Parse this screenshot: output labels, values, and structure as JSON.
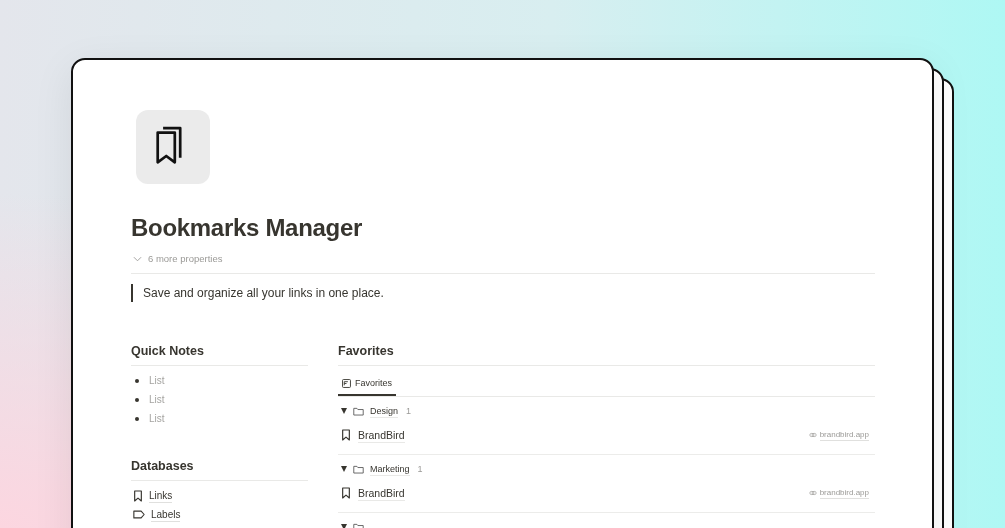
{
  "page": {
    "title": "Bookmarks Manager",
    "properties_toggle": "6 more properties",
    "quote": "Save and organize all your links in one place."
  },
  "quick_notes": {
    "heading": "Quick Notes",
    "items": [
      "List",
      "List",
      "List"
    ]
  },
  "databases": {
    "heading": "Databases",
    "items": [
      {
        "label": "Links",
        "kind": "bookmark"
      },
      {
        "label": "Labels",
        "kind": "label"
      }
    ]
  },
  "favorites": {
    "heading": "Favorites",
    "tabs": [
      {
        "label": "Favorites",
        "selected": true
      }
    ],
    "groups": [
      {
        "name": "Design",
        "count": "1",
        "expanded": true,
        "items": [
          {
            "title": "BrandBird",
            "url": "brandbird.app"
          }
        ]
      },
      {
        "name": "Marketing",
        "count": "1",
        "expanded": true,
        "items": [
          {
            "title": "BrandBird",
            "url": "brandbird.app"
          }
        ]
      },
      {
        "expanded": true
      }
    ]
  }
}
